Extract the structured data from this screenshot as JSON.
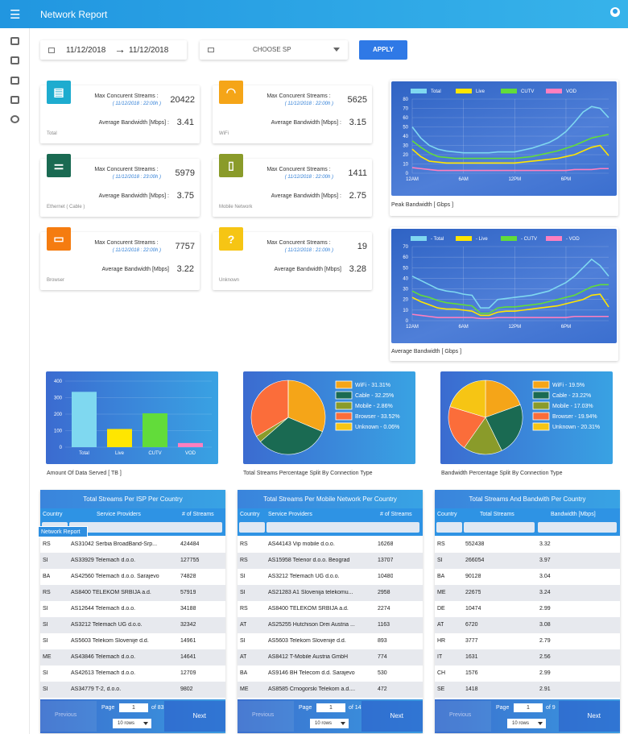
{
  "app": {
    "title": "Network Report",
    "tooltip": "Network Report"
  },
  "filters": {
    "date_from": "11/12/2018",
    "date_to": "11/12/2018",
    "arrow": "→",
    "sp_placeholder": "CHOOSE SP",
    "apply": "APPLY"
  },
  "cards": [
    {
      "name": "Total",
      "max_label": "Max Concurent Streams :",
      "date": "( 11/12/2018 : 22:00h )",
      "max": "20422",
      "bw_label": "Average Bandwidth [Mbps] :",
      "bw": "3.41",
      "color": "#1eaccf",
      "icon": "list-icon",
      "glyph": "▤"
    },
    {
      "name": "WiFi",
      "max_label": "Max Concurent Streams :",
      "date": "( 11/12/2018 : 22:00h )",
      "max": "5625",
      "bw_label": "Average Bandwidth [Mbps] :",
      "bw": "3.15",
      "color": "#f5a518",
      "icon": "wifi-icon",
      "glyph": "◠"
    },
    {
      "name": "Ethernet ( Cable )",
      "max_label": "Max Concurent Streams :",
      "date": "( 11/12/2018 : 23:00h )",
      "max": "5979",
      "bw_label": "Average Bandwidth [Mbps] :",
      "bw": "3.75",
      "color": "#1a6a52",
      "icon": "ethernet-icon",
      "glyph": "⚌"
    },
    {
      "name": "Mobile Network",
      "max_label": "Max Concurent Streams :",
      "date": "( 11/12/2018 : 22:00h )",
      "max": "1411",
      "bw_label": "Average Bandwidth [Mbps] :",
      "bw": "2.75",
      "color": "#8a9b2a",
      "icon": "mobile-icon",
      "glyph": "▯"
    },
    {
      "name": "Browser",
      "max_label": "Max Concurent Streams :",
      "date": "( 11/12/2018 : 22:00h )",
      "max": "7757",
      "bw_label": "Average Bandwidth [Mbps]",
      "bw": "3.22",
      "color": "#f57c10",
      "icon": "browser-icon",
      "glyph": "▭"
    },
    {
      "name": "Unknown",
      "max_label": "Max Concurent Streams :",
      "date": "( 11/12/2018 : 21:00h )",
      "max": "19",
      "bw_label": "Average Bandwidth [Mbps]",
      "bw": "3.28",
      "color": "#f6c514",
      "icon": "question-icon",
      "glyph": "?"
    }
  ],
  "chart_data": [
    {
      "type": "line",
      "title": "Peak Bandwidth [ Gbps ]",
      "ylim": [
        0,
        80
      ],
      "yticks": [
        "80",
        "70",
        "60",
        "50",
        "40",
        "30",
        "20",
        "10",
        "0"
      ],
      "xticks": [
        "12AM",
        "6AM",
        "12PM",
        "6PM"
      ],
      "legend_position": "top",
      "x": [
        0,
        1,
        2,
        3,
        4,
        5,
        6,
        7,
        8,
        9,
        10,
        11,
        12,
        13,
        14,
        15,
        16,
        17,
        18,
        19,
        20,
        21,
        22,
        23
      ],
      "series": [
        {
          "name": "Total",
          "color": "#7fd8f0",
          "values": [
            50,
            38,
            30,
            26,
            24,
            23,
            22,
            22,
            22,
            22,
            23,
            23,
            23,
            25,
            27,
            30,
            33,
            38,
            45,
            55,
            66,
            72,
            70,
            60
          ]
        },
        {
          "name": "Live",
          "color": "#ffe600",
          "values": [
            26,
            18,
            13,
            12,
            11,
            11,
            11,
            11,
            11,
            11,
            11,
            11,
            11,
            12,
            13,
            14,
            15,
            16,
            18,
            20,
            24,
            28,
            30,
            19
          ]
        },
        {
          "name": "CUTV",
          "color": "#62dc3a",
          "values": [
            35,
            28,
            22,
            18,
            17,
            16,
            16,
            16,
            16,
            16,
            16,
            16,
            16,
            17,
            18,
            20,
            22,
            24,
            27,
            30,
            34,
            38,
            40,
            42
          ]
        },
        {
          "name": "VOD",
          "color": "#ff7fbf",
          "values": [
            6,
            5,
            4,
            3,
            3,
            3,
            3,
            3,
            3,
            3,
            3,
            3,
            3,
            3,
            3,
            3,
            3,
            3,
            3,
            4,
            4,
            4,
            5,
            5
          ]
        }
      ]
    },
    {
      "type": "line",
      "title": "Average Bandwidth [ Gbps ]",
      "ylim": [
        0,
        70
      ],
      "yticks": [
        "70",
        "60",
        "50",
        "40",
        "30",
        "20",
        "10",
        "0"
      ],
      "xticks": [
        "12AM",
        "6AM",
        "12PM",
        "6PM"
      ],
      "legend_position": "top",
      "x": [
        0,
        1,
        2,
        3,
        4,
        5,
        6,
        7,
        8,
        9,
        10,
        11,
        12,
        13,
        14,
        15,
        16,
        17,
        18,
        19,
        20,
        21,
        22,
        23
      ],
      "series": [
        {
          "name": "- Total",
          "color": "#7fd8f0",
          "values": [
            42,
            38,
            34,
            30,
            28,
            27,
            25,
            24,
            12,
            12,
            20,
            21,
            22,
            23,
            24,
            26,
            28,
            32,
            36,
            42,
            50,
            58,
            52,
            42
          ]
        },
        {
          "name": "- Live",
          "color": "#ffe600",
          "values": [
            22,
            18,
            15,
            12,
            11,
            11,
            10,
            9,
            5,
            5,
            8,
            9,
            9,
            10,
            11,
            12,
            13,
            14,
            16,
            18,
            20,
            24,
            25,
            13
          ]
        },
        {
          "name": "- CUTV",
          "color": "#62dc3a",
          "values": [
            28,
            24,
            22,
            19,
            17,
            16,
            15,
            14,
            7,
            7,
            12,
            13,
            13,
            14,
            15,
            16,
            18,
            20,
            22,
            24,
            28,
            32,
            34,
            34
          ]
        },
        {
          "name": "- VOD",
          "color": "#ff7fbf",
          "values": [
            6,
            5,
            4,
            3,
            3,
            3,
            3,
            3,
            2,
            2,
            3,
            3,
            3,
            3,
            3,
            3,
            3,
            3,
            3,
            4,
            4,
            4,
            4,
            4
          ]
        }
      ]
    },
    {
      "type": "bar",
      "title": "Amount Of Data Served [ TB ]",
      "ylim": [
        0,
        400
      ],
      "yticks": [
        "400",
        "300",
        "200",
        "100",
        "0"
      ],
      "categories": [
        "Total",
        "Live",
        "CUTV",
        "VOD"
      ],
      "values": [
        335,
        110,
        205,
        25
      ],
      "colors": [
        "#7fd8f0",
        "#ffe600",
        "#62dc3a",
        "#ff7fbf"
      ]
    },
    {
      "type": "pie",
      "title": "Total Streams Percentage Split By Connection Type",
      "labels": [
        "WiFi - 31.31%",
        "Cable - 32.25%",
        "Mobile - 2.86%",
        "Browser - 33.52%",
        "Unknown - 0.06%"
      ],
      "values": [
        31.31,
        32.25,
        2.86,
        33.52,
        0.06
      ],
      "colors": [
        "#f5a518",
        "#1a6a52",
        "#8a9b2a",
        "#fb6d3a",
        "#f6c514"
      ]
    },
    {
      "type": "pie",
      "title": "Bandwidth Percentage Split By Connection Type",
      "labels": [
        "WiFi - 19.5%",
        "Cable - 23.22%",
        "Mobile - 17.03%",
        "Browser - 19.94%",
        "Unknown - 20.31%"
      ],
      "values": [
        19.5,
        23.22,
        17.03,
        19.94,
        20.31
      ],
      "colors": [
        "#f5a518",
        "#1a6a52",
        "#8a9b2a",
        "#fb6d3a",
        "#f6c514"
      ]
    }
  ],
  "tables": [
    {
      "title": "Total Streams Per ISP Per Country",
      "cols": [
        "Country",
        "Service Providers",
        "# of Streams"
      ],
      "rows": [
        [
          "RS",
          "AS31042 Serbia BroadBand-Srp...",
          "424484"
        ],
        [
          "SI",
          "AS33929 Telemach d.o.o.",
          "127755"
        ],
        [
          "BA",
          "AS42560 Telemach d.o.o. Sarajevo",
          "74828"
        ],
        [
          "RS",
          "AS8400 TELEKOM SRBIJA a.d.",
          "57919"
        ],
        [
          "SI",
          "AS12644 Telemach d.o.o.",
          "34188"
        ],
        [
          "SI",
          "AS3212 Telemach UG d.o.o.",
          "32342"
        ],
        [
          "SI",
          "AS5603 Telekom Slovenije d.d.",
          "14961"
        ],
        [
          "ME",
          "AS43846 Telemach d.o.o.",
          "14641"
        ],
        [
          "SI",
          "AS42613 Telemach d.o.o.",
          "12709"
        ],
        [
          "SI",
          "AS34779 T-2, d.o.o.",
          "9802"
        ]
      ],
      "pager": {
        "prev": "Previous",
        "page_label": "Page",
        "page": "1",
        "of": "of 83",
        "rows": "10 rows",
        "next": "Next"
      }
    },
    {
      "title": "Total Streams Per Mobile Network Per Country",
      "cols": [
        "Country",
        "Service Providers",
        "# of Streams"
      ],
      "rows": [
        [
          "RS",
          "AS44143 Vip mobile d.o.o.",
          "16268"
        ],
        [
          "RS",
          "AS15958 Telenor d.o.o. Beograd",
          "13707"
        ],
        [
          "SI",
          "AS3212 Telemach UG d.o.o.",
          "10480"
        ],
        [
          "SI",
          "AS21283 A1 Slovenija telekomu...",
          "2958"
        ],
        [
          "RS",
          "AS8400 TELEKOM SRBIJA a.d.",
          "2274"
        ],
        [
          "AT",
          "AS25255 Hutchison Drei Austria ...",
          "1163"
        ],
        [
          "SI",
          "AS5603 Telekom Slovenije d.d.",
          "893"
        ],
        [
          "AT",
          "AS8412 T-Mobile Austria GmbH",
          "774"
        ],
        [
          "BA",
          "AS9146 BH Telecom d.d. Sarajevo",
          "530"
        ],
        [
          "ME",
          "AS8585 Crnogorski Telekom a.d....",
          "472"
        ]
      ],
      "pager": {
        "prev": "Previous",
        "page_label": "Page",
        "page": "1",
        "of": "of 14",
        "rows": "10 rows",
        "next": "Next"
      }
    },
    {
      "title": "Total Streams And Bandwith Per Country",
      "cols": [
        "Country",
        "Total Streams",
        "Bandwidth [Mbps]"
      ],
      "rows": [
        [
          "RS",
          "552438",
          "3.32"
        ],
        [
          "SI",
          "266054",
          "3.97"
        ],
        [
          "BA",
          "90128",
          "3.04"
        ],
        [
          "ME",
          "22675",
          "3.24"
        ],
        [
          "DE",
          "10474",
          "2.99"
        ],
        [
          "AT",
          "6720",
          "3.08"
        ],
        [
          "HR",
          "3777",
          "2.79"
        ],
        [
          "IT",
          "1631",
          "2.56"
        ],
        [
          "CH",
          "1576",
          "2.99"
        ],
        [
          "SE",
          "1418",
          "2.91"
        ]
      ],
      "pager": {
        "prev": "Previous",
        "page_label": "Page",
        "page": "1",
        "of": "of 9",
        "rows": "10 rows",
        "next": "Next"
      }
    }
  ]
}
